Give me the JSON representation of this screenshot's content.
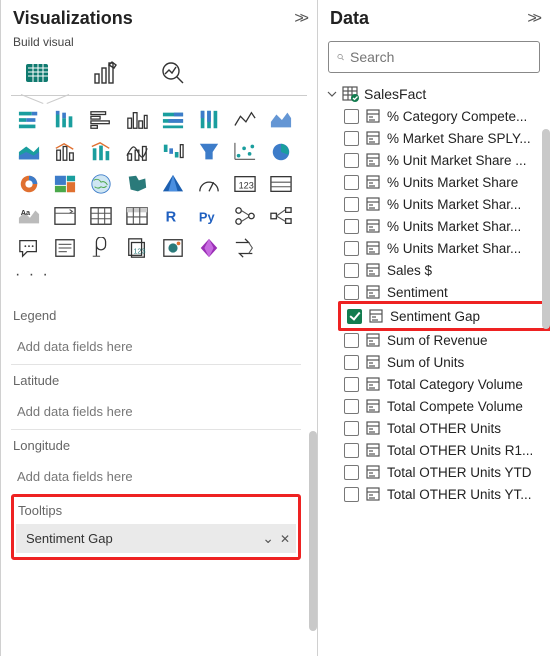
{
  "viz": {
    "title": "Visualizations",
    "subtitle": "Build visual",
    "tabs": [
      "build",
      "format",
      "analyze"
    ],
    "ellipsis": "· · ·",
    "wells": {
      "legend": {
        "label": "Legend",
        "placeholder": "Add data fields here"
      },
      "latitude": {
        "label": "Latitude",
        "placeholder": "Add data fields here"
      },
      "longitude": {
        "label": "Longitude",
        "placeholder": "Add data fields here"
      },
      "tooltips": {
        "label": "Tooltips",
        "chip": "Sentiment Gap"
      }
    }
  },
  "data": {
    "title": "Data",
    "search_placeholder": "Search",
    "table": "SalesFact",
    "fields": [
      {
        "label": "% Category Compete...",
        "checked": false
      },
      {
        "label": "% Market Share SPLY...",
        "checked": false
      },
      {
        "label": "% Unit Market Share ...",
        "checked": false
      },
      {
        "label": "% Units Market Share",
        "checked": false
      },
      {
        "label": "% Units Market Shar...",
        "checked": false
      },
      {
        "label": "% Units Market Shar...",
        "checked": false
      },
      {
        "label": "% Units Market Shar...",
        "checked": false
      },
      {
        "label": "Sales $",
        "checked": false
      },
      {
        "label": "Sentiment",
        "checked": false
      },
      {
        "label": "Sentiment Gap",
        "checked": true,
        "highlight": true
      },
      {
        "label": "Sum of Revenue",
        "checked": false
      },
      {
        "label": "Sum of Units",
        "checked": false
      },
      {
        "label": "Total Category Volume",
        "checked": false
      },
      {
        "label": "Total Compete Volume",
        "checked": false
      },
      {
        "label": "Total OTHER Units",
        "checked": false
      },
      {
        "label": "Total OTHER Units R1...",
        "checked": false
      },
      {
        "label": "Total OTHER Units YTD",
        "checked": false
      },
      {
        "label": "Total OTHER Units YT...",
        "checked": false
      }
    ]
  },
  "icons": {
    "collapse": ">>",
    "chevdown": "⌄",
    "close": "✕",
    "search": "search"
  }
}
